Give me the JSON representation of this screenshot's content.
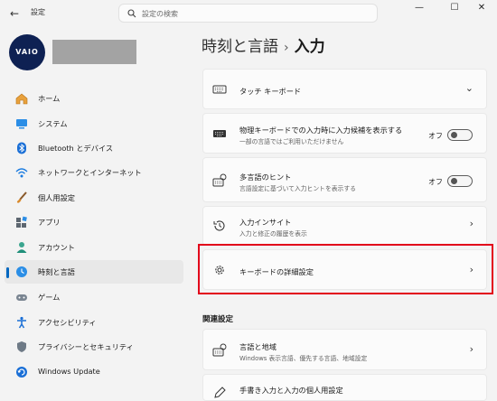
{
  "titlebar": {
    "back": "←",
    "app_title": "設定",
    "search_placeholder": "設定の検索",
    "minimize": "—",
    "maximize": "☐",
    "close": "✕"
  },
  "user": {
    "avatar_text": "VAIO",
    "name": ""
  },
  "sidebar": {
    "items": [
      {
        "label": "ホーム",
        "icon": "home-icon"
      },
      {
        "label": "システム",
        "icon": "system-icon"
      },
      {
        "label": "Bluetooth とデバイス",
        "icon": "bluetooth-icon"
      },
      {
        "label": "ネットワークとインターネット",
        "icon": "wifi-icon"
      },
      {
        "label": "個人用設定",
        "icon": "brush-icon"
      },
      {
        "label": "アプリ",
        "icon": "apps-icon"
      },
      {
        "label": "アカウント",
        "icon": "account-icon"
      },
      {
        "label": "時刻と言語",
        "icon": "time-language-icon",
        "active": true
      },
      {
        "label": "ゲーム",
        "icon": "gamepad-icon"
      },
      {
        "label": "アクセシビリティ",
        "icon": "accessibility-icon"
      },
      {
        "label": "プライバシーとセキュリティ",
        "icon": "shield-icon"
      },
      {
        "label": "Windows Update",
        "icon": "update-icon"
      }
    ]
  },
  "breadcrumb": {
    "parent": "時刻と言語",
    "separator": "›",
    "current": "入力"
  },
  "cards": {
    "touch_keyboard": {
      "title": "タッチ キーボード",
      "chevron": "⌄"
    },
    "physical_keyboard": {
      "title": "物理キーボードでの入力時に入力候補を表示する",
      "subtitle": "一部の言語ではご利用いただけません",
      "toggle_label": "オフ",
      "toggle_on": false
    },
    "multilingual": {
      "title": "多言語のヒント",
      "subtitle": "言語設定に基づいて入力ヒントを表示する",
      "toggle_label": "オフ",
      "toggle_on": false
    },
    "typing_insights": {
      "title": "入力インサイト",
      "subtitle": "入力と修正の履歴を表示",
      "chevron": "›"
    },
    "advanced_keyboard": {
      "title": "キーボードの詳細設定",
      "chevron": "›"
    },
    "region": {
      "title": "言語と地域",
      "subtitle": "Windows 表示言語、優先する言語、地域設定",
      "chevron": "›"
    },
    "partial": {
      "title": "手書き入力と入力の個人用設定"
    }
  },
  "related_settings_heading": "関連設定",
  "colors": {
    "accent": "#0067c0",
    "highlight": "#e2001a"
  }
}
